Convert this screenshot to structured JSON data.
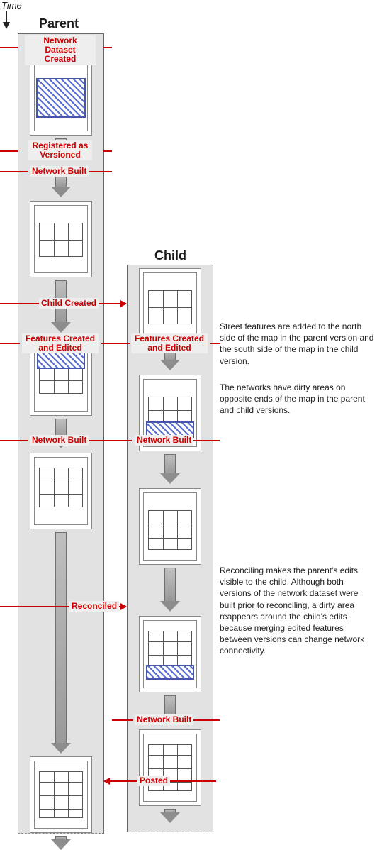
{
  "time_label": "Time",
  "columns": {
    "parent": "Parent",
    "child": "Child"
  },
  "labels": {
    "nd_created": "Network Dataset\nCreated",
    "registered": "Registered as\nVersioned",
    "net_built": "Network Built",
    "child_created": "Child Created",
    "features_edited": "Features Created\nand Edited",
    "reconciled": "Reconciled",
    "posted": "Posted"
  },
  "notes": {
    "n1": "Street features are added to the north side of the map in the parent version and the south side of the map in the child version.",
    "n2": "The networks have dirty areas on opposite ends of the map in the parent and child versions.",
    "n3": "Reconciling makes the parent's edits visible to the child. Although both versions of the network dataset were built prior to reconciling, a dirty area reappears around the child's edits because merging edited features between versions can change network connectivity."
  }
}
